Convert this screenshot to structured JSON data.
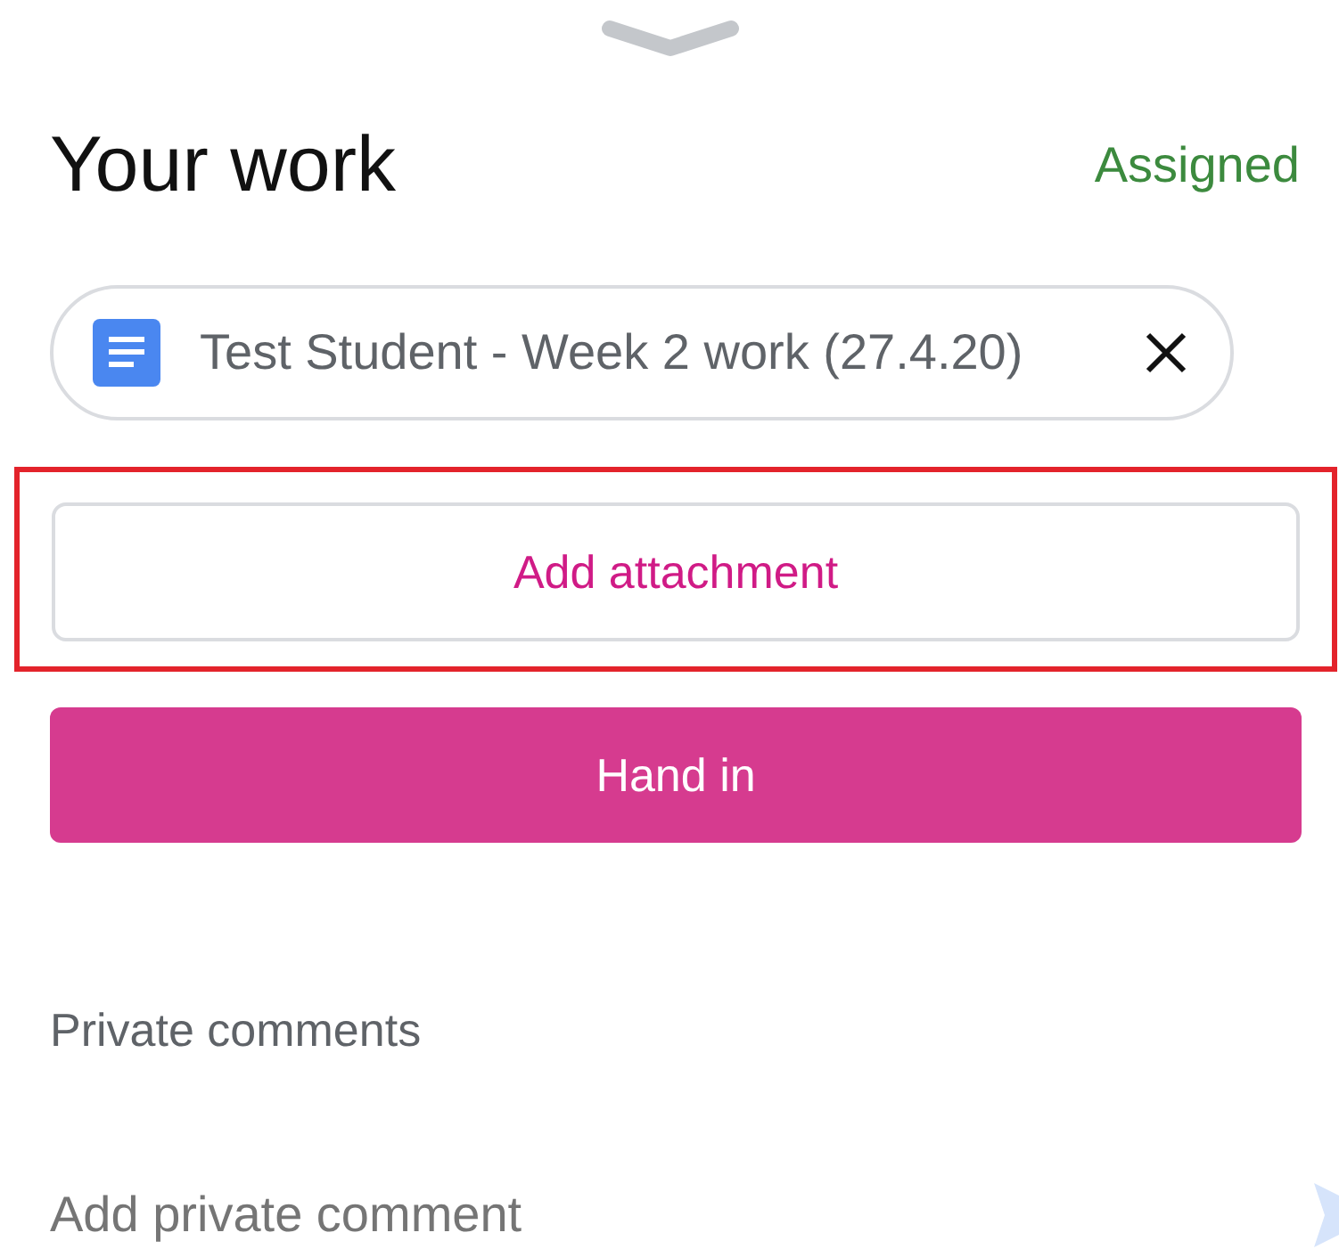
{
  "header": {
    "title": "Your work",
    "status": "Assigned"
  },
  "attachments": [
    {
      "name": "Test Student - Week 2 work (27.4.20)"
    }
  ],
  "add_attachment": {
    "label": "Add attachment",
    "highlighted": true
  },
  "hand_in": {
    "label": "Hand in",
    "disabled": false
  },
  "private_comments": {
    "heading": "Private comments",
    "placeholder": "Add private comment"
  }
}
